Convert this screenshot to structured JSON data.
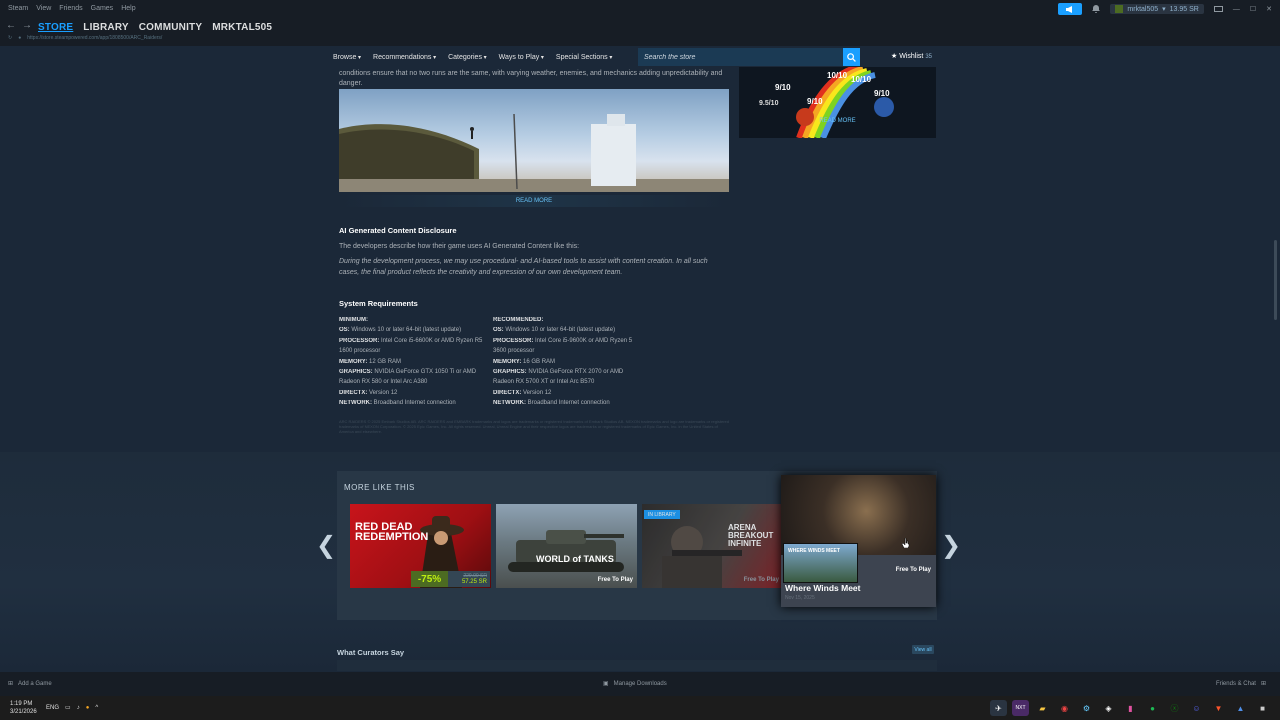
{
  "titlebar": {
    "app_name": "Steam",
    "menu": [
      "View",
      "Friends",
      "Games",
      "Help"
    ],
    "user": "mrktal505",
    "balance": "13.95 SR"
  },
  "nav": {
    "tabs": [
      "STORE",
      "LIBRARY",
      "COMMUNITY",
      "MRKTAL505"
    ],
    "url": "https://store.steampowered.com/app/1808500/ARC_Raiders/"
  },
  "store_nav": {
    "items": [
      "Browse",
      "Recommendations",
      "Categories",
      "Ways to Play",
      "Special Sections"
    ],
    "search_placeholder": "Search the store",
    "wishlist_label": "Wishlist",
    "wishlist_count": "35"
  },
  "about": {
    "description": "conditions ensure that no two runs are the same, with varying weather, enemies, and mechanics adding unpredictability and danger.",
    "read_more": "READ MORE",
    "review_scores": [
      "9/10",
      "10/10",
      "10/10",
      "9.5/10",
      "9/10",
      "9/10"
    ]
  },
  "ai_disclosure": {
    "heading": "AI Generated Content Disclosure",
    "intro": "The developers describe how their game uses AI Generated Content like this:",
    "quote": "During the development process, we may use procedural- and AI-based tools to assist with content creation. In all such cases, the final product reflects the creativity and expression of our own development team."
  },
  "sysreq": {
    "heading": "System Requirements",
    "minimum": {
      "title": "MINIMUM:",
      "rows": [
        {
          "label": "OS:",
          "value": "Windows 10 or later 64-bit (latest update)"
        },
        {
          "label": "Processor:",
          "value": "Intel Core i5-6600K or AMD Ryzen R5 1600 processor"
        },
        {
          "label": "Memory:",
          "value": "12 GB RAM"
        },
        {
          "label": "Graphics:",
          "value": "NVIDIA GeForce GTX 1050 Ti or AMD Radeon RX 580 or Intel Arc A380"
        },
        {
          "label": "DirectX:",
          "value": "Version 12"
        },
        {
          "label": "Network:",
          "value": "Broadband Internet connection"
        }
      ]
    },
    "recommended": {
      "title": "RECOMMENDED:",
      "rows": [
        {
          "label": "OS:",
          "value": "Windows 10 or later 64-bit (latest update)"
        },
        {
          "label": "Processor:",
          "value": "Intel Core i5-9600K or AMD Ryzen 5 3600 processor"
        },
        {
          "label": "Memory:",
          "value": "16 GB RAM"
        },
        {
          "label": "Graphics:",
          "value": "NVIDIA GeForce RTX 2070 or AMD Radeon RX 5700 XT or Intel Arc B570"
        },
        {
          "label": "DirectX:",
          "value": "Version 12"
        },
        {
          "label": "Network:",
          "value": "Broadband Internet connection"
        }
      ]
    },
    "legal": "ARC RAIDERS © 2025 Embark Studios AB. ARC RAIDERS and EMBARK trademarks and logos are trademarks or registered trademarks of Embark Studios AB. NEXON trademarks and logo are trademarks or registered trademarks of NEXON Corporation. © 2025 Epic Games, Inc. All rights reserved. Unreal, Unreal Engine and their respective logos are trademarks or registered trademarks of Epic Games, Inc. in the United States of America and elsewhere."
  },
  "more_like_this": {
    "title": "MORE LIKE THIS",
    "items": [
      {
        "name": "RED DEAD REDEMPTION",
        "badge": "",
        "discount": "-75%",
        "original_price": "229.00 SR",
        "price": "57.25 SR",
        "label": ""
      },
      {
        "name": "WORLD of TANKS",
        "badge": "",
        "label": "Free To Play"
      },
      {
        "name": "ARENA BREAKOUT INFINITE",
        "badge": "IN LIBRARY",
        "label": "Free To Play"
      }
    ],
    "hover": {
      "name": "Where Winds Meet",
      "thumb_text": "WHERE WINDS MEET",
      "label": "Free To Play",
      "date": "Nov 15, 2025"
    }
  },
  "curators": {
    "heading": "What Curators Say",
    "view_all": "View all"
  },
  "statusbar": {
    "add_game": "Add a Game",
    "downloads": "Manage Downloads",
    "friends": "Friends & Chat"
  },
  "taskbar": {
    "time": "1:19 PM",
    "date": "3/21/2026",
    "lang": "ENG"
  },
  "colors": {
    "accent": "#1a9fff",
    "link": "#67c1f5",
    "discount_bg": "#4c6b22",
    "discount_text": "#beee11"
  }
}
